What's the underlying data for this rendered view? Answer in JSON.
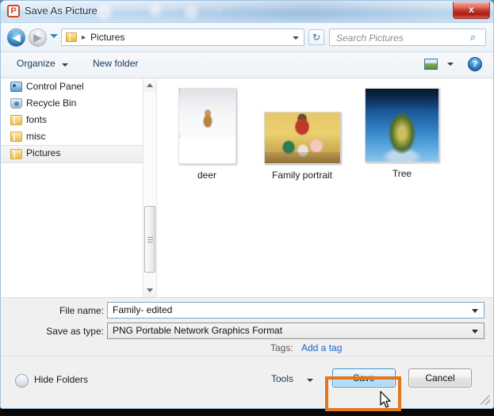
{
  "window": {
    "title": "Save As Picture",
    "app_icon": "P",
    "close_label": "x"
  },
  "nav": {
    "back_icon": "◀",
    "forward_icon": "▶",
    "breadcrumb_separator": "▸",
    "path": "Pictures",
    "refresh_icon": "↻",
    "search_placeholder": "Search Pictures",
    "search_icon": "⌕"
  },
  "toolbar": {
    "organize": "Organize",
    "new_folder": "New folder",
    "help": "?"
  },
  "sidebar": {
    "items": [
      {
        "label": "Control Panel",
        "icon": "control-panel-icon",
        "selected": false
      },
      {
        "label": "Recycle Bin",
        "icon": "recycle-bin-icon",
        "selected": false
      },
      {
        "label": "fonts",
        "icon": "folder-icon",
        "selected": false
      },
      {
        "label": "misc",
        "icon": "folder-icon",
        "selected": false
      },
      {
        "label": "Pictures",
        "icon": "folder-icon",
        "selected": true
      }
    ]
  },
  "files": [
    {
      "name": "deer"
    },
    {
      "name": "Family portrait"
    },
    {
      "name": "Tree"
    }
  ],
  "form": {
    "filename_label": "File name:",
    "filename_value": "Family- edited",
    "filetype_label": "Save as type:",
    "filetype_value": "PNG Portable Network Graphics Format",
    "tags_label": "Tags:",
    "add_tag_link": "Add a tag"
  },
  "footer": {
    "hide_folders": "Hide Folders",
    "tools": "Tools",
    "save": "Save",
    "cancel": "Cancel"
  },
  "colors": {
    "highlight_box": "#e2761b",
    "link": "#1566c0",
    "close_button": "#c33527"
  }
}
